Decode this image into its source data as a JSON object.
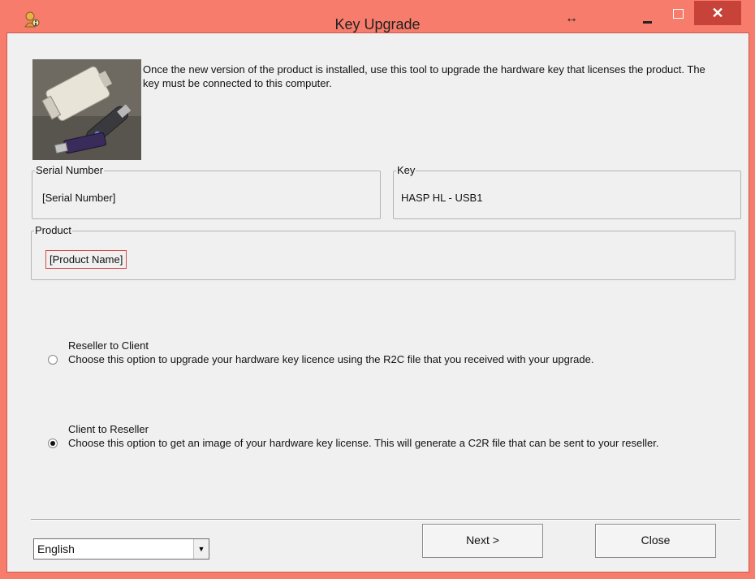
{
  "window": {
    "title": "Key Upgrade",
    "resize_glyph": "↔",
    "close_glyph": "✕"
  },
  "intro_text": "Once the new version of the product is installed, use this tool to upgrade the hardware key that licenses the product. The key must be connected to this computer.",
  "serial": {
    "label": "Serial Number",
    "value": "[Serial Number]"
  },
  "key": {
    "label": "Key",
    "value": "HASP HL - USB1"
  },
  "product": {
    "label": "Product",
    "value": "[Product Name]"
  },
  "options": {
    "r2c": {
      "title": "Reseller to Client",
      "description": "Choose this option to upgrade your hardware key licence using the R2C file that you received with your upgrade.",
      "checked": false
    },
    "c2r": {
      "title": "Client to Reseller",
      "description": "Choose this option to get an image of your hardware key license. This will generate a C2R file that can be sent to your reseller.",
      "checked": true
    }
  },
  "language": {
    "selected": "English"
  },
  "buttons": {
    "next": "Next >",
    "close": "Close"
  },
  "icons": {
    "app": "key-user-icon",
    "photo": "hardware-key-photo"
  }
}
